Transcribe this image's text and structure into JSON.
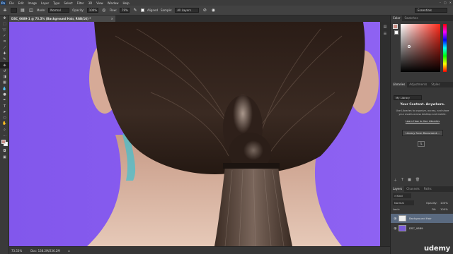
{
  "menubar": {
    "app_badge": "Ps",
    "items": [
      "File",
      "Edit",
      "Image",
      "Layer",
      "Type",
      "Select",
      "Filter",
      "3D",
      "View",
      "Window",
      "Help"
    ]
  },
  "options": {
    "mode_label": "Mode:",
    "mode_value": "Normal",
    "opacity_label": "Opacity:",
    "opacity_value": "100%",
    "flow_label": "Flow:",
    "flow_value": "79%",
    "sample_label": "Aligned",
    "sample_layers_label": "Sample:",
    "sample_layers_value": "All Layers",
    "workspace": "Essentials"
  },
  "document_tab": {
    "title": "DSC_0689-1 @ 73.5% (Background Hair, RGB/16) *",
    "close": "×"
  },
  "status": {
    "zoom": "73.53%",
    "doc": "Doc: 138.2M/236.2M"
  },
  "color_panel": {
    "tabs": [
      "Color",
      "Swatches"
    ],
    "fg_color": "#c98d84"
  },
  "libraries_panel": {
    "tabs": [
      "Libraries",
      "Adjustments",
      "Styles"
    ],
    "library_select": "My Library",
    "title": "Your Content. Anywhere.",
    "description": "Use Libraries to organize, access, and share your assets across desktop and mobile.",
    "link": "Learn How to Use Libraries",
    "button": "Library from Document..."
  },
  "layers_panel": {
    "tabs": [
      "Layers",
      "Channels",
      "Paths"
    ],
    "kind_label": "Kind",
    "blend_mode": "Normal",
    "opacity_label": "Opacity:",
    "opacity_value": "100%",
    "lock_label": "Lock:",
    "fill_label": "Fill:",
    "fill_value": "100%",
    "layers": [
      {
        "name": "Background Hair",
        "selected": true
      },
      {
        "name": "DSC_0689",
        "selected": false
      }
    ]
  },
  "watermark": "udemy",
  "colors": {
    "backdrop": "#8a5ff0",
    "ui_dark": "#383838",
    "selected_layer": "#5a6a80"
  }
}
